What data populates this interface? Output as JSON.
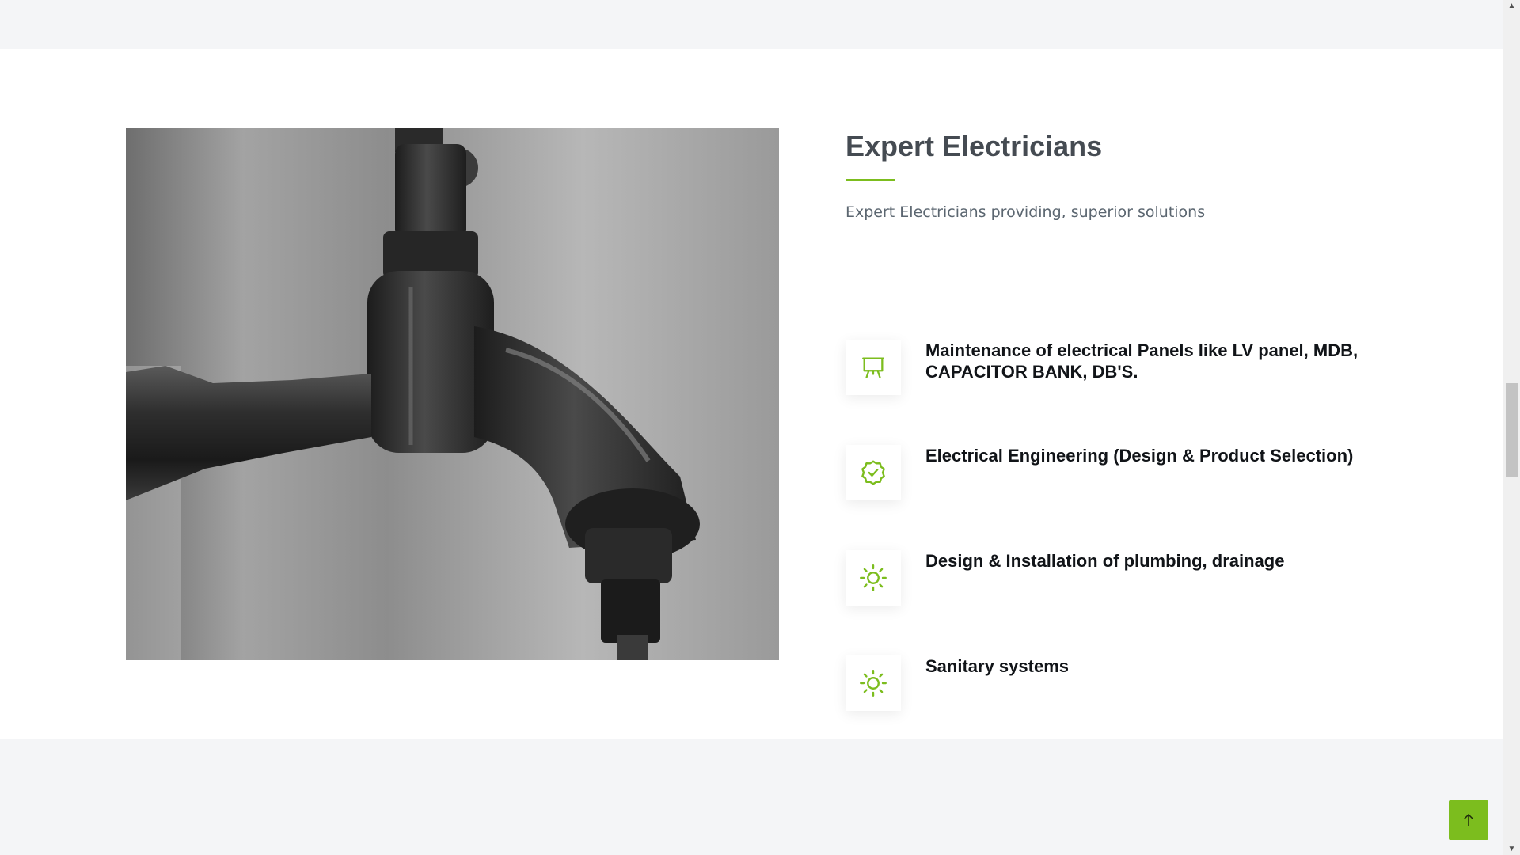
{
  "colors": {
    "accent": "#7cbd1e",
    "heading": "#454b52",
    "subtitle": "#5b6670",
    "feature_text": "#111418",
    "section_background": "#ffffff",
    "page_background": "#f4f5f7"
  },
  "section": {
    "image": {
      "icon": "water-faucet-photo"
    },
    "title": "Expert Electricians",
    "subtitle": "Expert Electricians providing, superior solutions",
    "features": [
      {
        "icon": "presentation-board-icon",
        "label": "Maintenance of electrical Panels like LV panel, MDB, CAPACITOR BANK, DB'S."
      },
      {
        "icon": "badge-check-icon",
        "label": "Electrical Engineering (Design & Product Selection)"
      },
      {
        "icon": "sun-icon",
        "label": "Design & Installation of plumbing, drainage"
      },
      {
        "icon": "sun-icon",
        "label": "Sanitary systems"
      }
    ]
  },
  "back_to_top": {
    "icon": "arrow-up-icon"
  },
  "scrollbar": {
    "up_icon": "triangle-up-icon",
    "down_icon": "triangle-down-icon"
  }
}
